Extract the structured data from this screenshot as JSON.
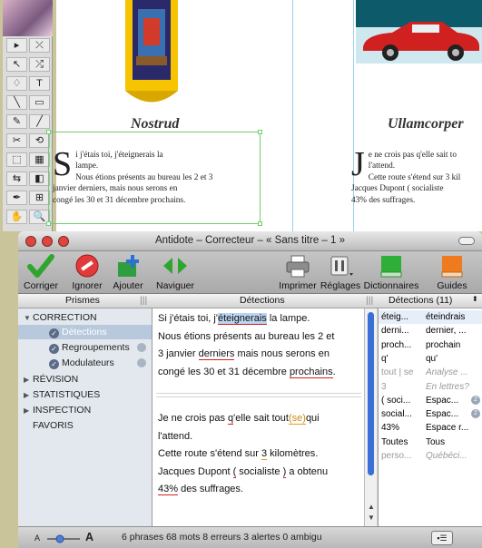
{
  "document": {
    "heading_left": "Nostrud",
    "heading_right": "Ullamcorper",
    "left_dropcap": "S",
    "left_first_line": "i j'étais toi, j'éteignerais la",
    "left_rest": "lampe.\nNous étions présents au bureau les 2 et 3\njanvier derniers, mais nous serons en\ncongé les 30 et 31 décembre prochains.",
    "right_dropcap": "J",
    "right_first_line": "e ne crois pas q'elle sait to",
    "right_rest": "l'attend.\nCette route s'étend sur 3 kil\nJacques Dupont ( socialiste\n43% des suffrages."
  },
  "tools": [
    "▸",
    "⤫",
    "↖",
    "⤮",
    "♢",
    "T",
    "╲",
    "▭",
    "✎",
    "╱",
    "✂",
    "⟲",
    "⬚",
    "▦",
    "⇆",
    "◧",
    "✒",
    "⊞",
    "✋",
    "🔍"
  ],
  "window": {
    "title": "Antidote – Correcteur – « Sans titre – 1 »",
    "toolbar": {
      "corriger": "Corriger",
      "ignorer": "Ignorer",
      "ajouter": "Ajouter",
      "naviguer": "Naviguer",
      "imprimer": "Imprimer",
      "reglages": "Réglages",
      "dictionnaires": "Dictionnaires",
      "guides": "Guides"
    },
    "columns": {
      "prismes": "Prismes",
      "detections": "Détections",
      "detections_count": "Détections (11)"
    },
    "sidebar": {
      "correction": "CORRECTION",
      "detections": "Détections",
      "regroupements": "Regroupements",
      "modulateurs": "Modulateurs",
      "revision": "RÉVISION",
      "statistiques": "STATISTIQUES",
      "inspection": "INSPECTION",
      "favoris": "FAVORIS"
    },
    "text": {
      "p1_a": "Si j'étais toi, j'",
      "p1_b": "éteignerais",
      "p1_c": " la lampe.",
      "p1_line2": "Nous étions présents au bureau les 2 et",
      "p1_line3_a": "3 janvier ",
      "p1_line3_b": "derniers",
      "p1_line3_c": " mais nous serons en",
      "p1_line4_a": "congé les 30 et 31 décembre ",
      "p1_line4_b": "prochains",
      "p1_line4_c": ".",
      "p2_a": "Je ne crois pas ",
      "p2_b": "q",
      "p2_c": "'elle sait tout",
      "p2_d": "(se)",
      "p2_e": "qui",
      "p2_line2": "l'attend.",
      "p2_line3_a": "Cette route s'étend sur ",
      "p2_line3_b": "3",
      "p2_line3_c": " kilomètres.",
      "p2_line4_a": "Jacques Dupont ",
      "p2_line4_b": "(",
      "p2_line4_c": " socialiste ",
      "p2_line4_d": ")",
      "p2_line4_e": " a obtenu",
      "p2_line5_a": "43%",
      "p2_line5_b": " des suffrages."
    },
    "detections": [
      {
        "c1": "éteig...",
        "c2": "éteindrais",
        "dim": false
      },
      {
        "c1": "derni...",
        "c2": "dernier, ...",
        "dim": false
      },
      {
        "c1": "proch...",
        "c2": "prochain",
        "dim": false
      },
      {
        "c1": "q'",
        "c2": "qu'",
        "dim": false
      },
      {
        "c1": "tout | se",
        "c2": "Analyse ...",
        "dim": true
      },
      {
        "c1": "3",
        "c2": "En lettres?",
        "dim": true
      },
      {
        "c1": "( soci...",
        "c2": "Espac...",
        "dim": false,
        "badge": "2"
      },
      {
        "c1": "social...",
        "c2": "Espac...",
        "dim": false,
        "badge": "2"
      },
      {
        "c1": "43%",
        "c2": "Espace r...",
        "dim": false
      },
      {
        "c1": "Toutes",
        "c2": "Tous",
        "dim": false
      },
      {
        "c1": "perso...",
        "c2": "Québéci...",
        "dim": true
      }
    ],
    "status": {
      "font_small": "A",
      "font_large": "A",
      "summary": "6 phrases  68 mots  8 erreurs  3 alertes  0 ambigu"
    }
  }
}
